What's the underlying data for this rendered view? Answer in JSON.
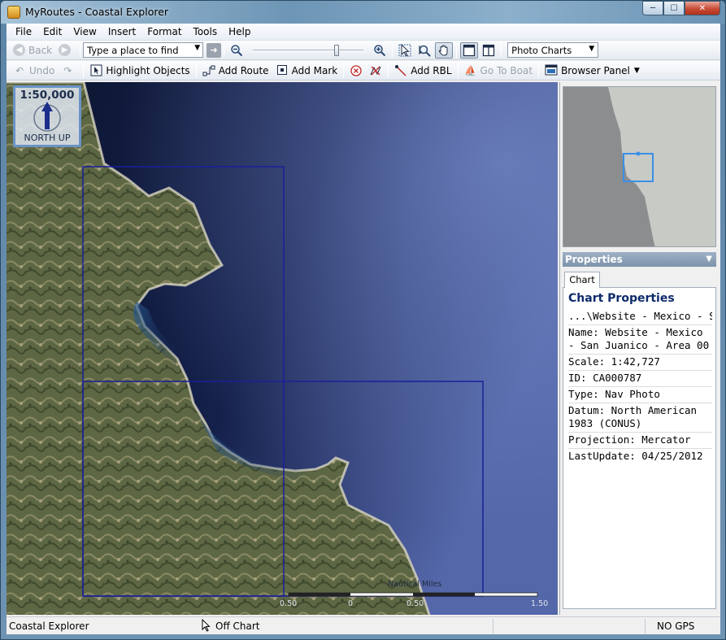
{
  "window": {
    "title": "MyRoutes - Coastal Explorer",
    "buttons": {
      "minimize": "─",
      "maximize": "☐",
      "close": "✕"
    }
  },
  "menubar": {
    "items": [
      "File",
      "Edit",
      "View",
      "Insert",
      "Format",
      "Tools",
      "Help"
    ]
  },
  "toolbar1": {
    "back_label": "Back",
    "search_placeholder": "Type a place to find",
    "zoom_slider_value": 0.78,
    "chart_type_selected": "Photo Charts"
  },
  "toolbar2": {
    "undo_label": "Undo",
    "highlight_label": "Highlight Objects",
    "add_route_label": "Add Route",
    "add_mark_label": "Add Mark",
    "add_rbl_label": "Add RBL",
    "go_to_boat_label": "Go To Boat",
    "browser_panel_label": "Browser Panel"
  },
  "map": {
    "scale_ratio": "1:50,000",
    "orientation": "NORTH UP",
    "scale_bar": {
      "title": "Nautical Miles",
      "labels": [
        "0.50",
        "0",
        "0.50",
        "1.50"
      ]
    }
  },
  "properties": {
    "header": "Properties",
    "tab": "Chart",
    "title": "Chart Properties",
    "path": "...\\Website - Mexico - San",
    "name": "Name: Website - Mexico - San Juanico - Area 00",
    "scale": "Scale: 1:42,727",
    "id": "ID: CA000787",
    "type": "Type: Nav Photo",
    "datum": "Datum: North American 1983 (CONUS)",
    "projection": "Projection: Mercator",
    "last_update": "LastUpdate: 04/25/2012"
  },
  "statusbar": {
    "app": "Coastal Explorer",
    "chart_status": "Off Chart",
    "gps": "NO GPS"
  },
  "colors": {
    "ocean": "#0f1b3b",
    "chart_frame": "#1a1f9a",
    "land": "#5f6a44",
    "header_text": "#0d2a6b",
    "viewport_box": "#3b8fe6"
  }
}
